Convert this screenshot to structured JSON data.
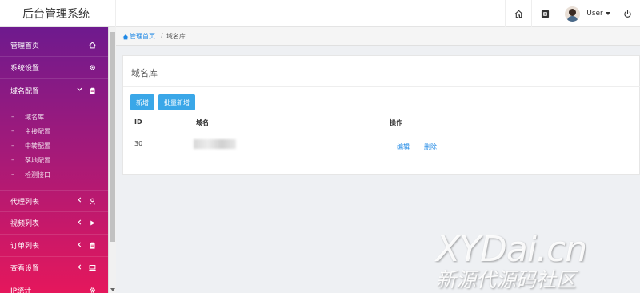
{
  "app": {
    "title": "后台管理系统"
  },
  "header": {
    "user_label": "User"
  },
  "sidebar": {
    "items": [
      {
        "label": "管理首页",
        "icon": "home-icon"
      },
      {
        "label": "系统设置",
        "icon": "gear-icon"
      },
      {
        "label": "域名配置",
        "icon": "clipboard-icon",
        "expanded": true,
        "children": [
          "域名库",
          "主接配置",
          "中转配置",
          "落地配置",
          "检测接口"
        ]
      },
      {
        "label": "代理列表",
        "icon": "user-icon"
      },
      {
        "label": "视频列表",
        "icon": "play-icon"
      },
      {
        "label": "订单列表",
        "icon": "clipboard-icon"
      },
      {
        "label": "查看设置",
        "icon": "monitor-icon"
      },
      {
        "label": "IP统计",
        "icon": "gear-icon"
      }
    ]
  },
  "breadcrumb": {
    "home": "管理首页",
    "separator": "/",
    "current": "域名库"
  },
  "panel": {
    "title": "域名库",
    "buttons": {
      "add": "新增",
      "batch_add": "批量新增"
    },
    "table": {
      "headers": [
        "ID",
        "域名",
        "操作"
      ],
      "rows": [
        {
          "id": "30",
          "domain": "",
          "actions": [
            "编辑",
            "删除"
          ]
        }
      ]
    }
  },
  "watermark": {
    "line1": "XYDai.cn",
    "line2": "新源代源码社区"
  },
  "colors": {
    "sidebar_top": "#6e1a8e",
    "sidebar_bottom": "#e5175c",
    "accent": "#3aa7e8",
    "link": "#1e88e5"
  }
}
